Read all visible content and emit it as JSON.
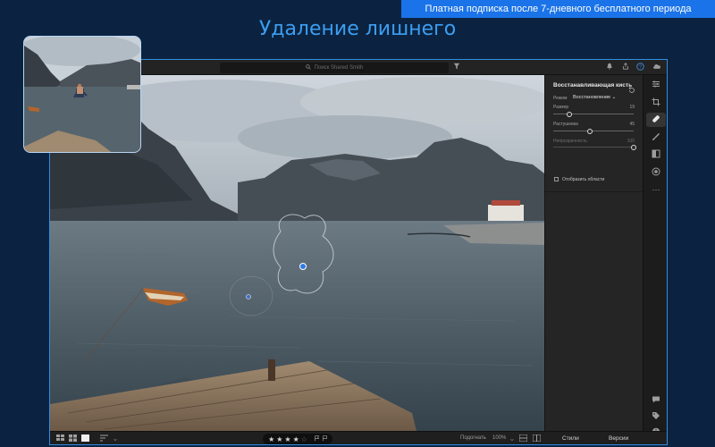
{
  "promo_banner": "Платная подписка после 7-дневного бесплатного периода",
  "headline": "Удаление лишнего",
  "topbar": {
    "search_placeholder": "Поиск Shared Smith",
    "search_icon": "search-icon",
    "filter_icon": "filter-icon",
    "icons": [
      "bell-icon",
      "share-icon",
      "help-icon",
      "cloud-icon"
    ]
  },
  "panel": {
    "title": "Восстанавливающая кисть",
    "mode_label": "Режим",
    "mode_value": "Восстановление",
    "sliders": [
      {
        "label": "Размер",
        "value": "19",
        "level": 0.2
      },
      {
        "label": "Растушевка",
        "value": "45",
        "level": 0.45
      },
      {
        "label": "Непрозрачность",
        "value": "100",
        "level": 1.0
      }
    ],
    "show_areas_label": "Отобразить области"
  },
  "rail": {
    "icons": [
      "sliders-icon",
      "crop-icon",
      "healing-brush-icon",
      "brush-icon",
      "gradient-icon",
      "radial-icon",
      "more-icon",
      "comment-icon",
      "tag-icon",
      "info-icon"
    ],
    "active": "healing-brush-icon"
  },
  "bottombar": {
    "view_icons": [
      "grid-view-icon",
      "square-grid-icon",
      "single-view-icon",
      "sort-icon"
    ],
    "rating": 4,
    "max_rating": 5,
    "fit_label": "Подогнать",
    "zoom_label": "100%",
    "tab_styles": "Стили",
    "tab_versions": "Версии"
  },
  "colors": {
    "background": "#0b2340",
    "accent": "#1a73e8",
    "headline": "#3c9ef2",
    "window_border": "#2f8de0"
  }
}
